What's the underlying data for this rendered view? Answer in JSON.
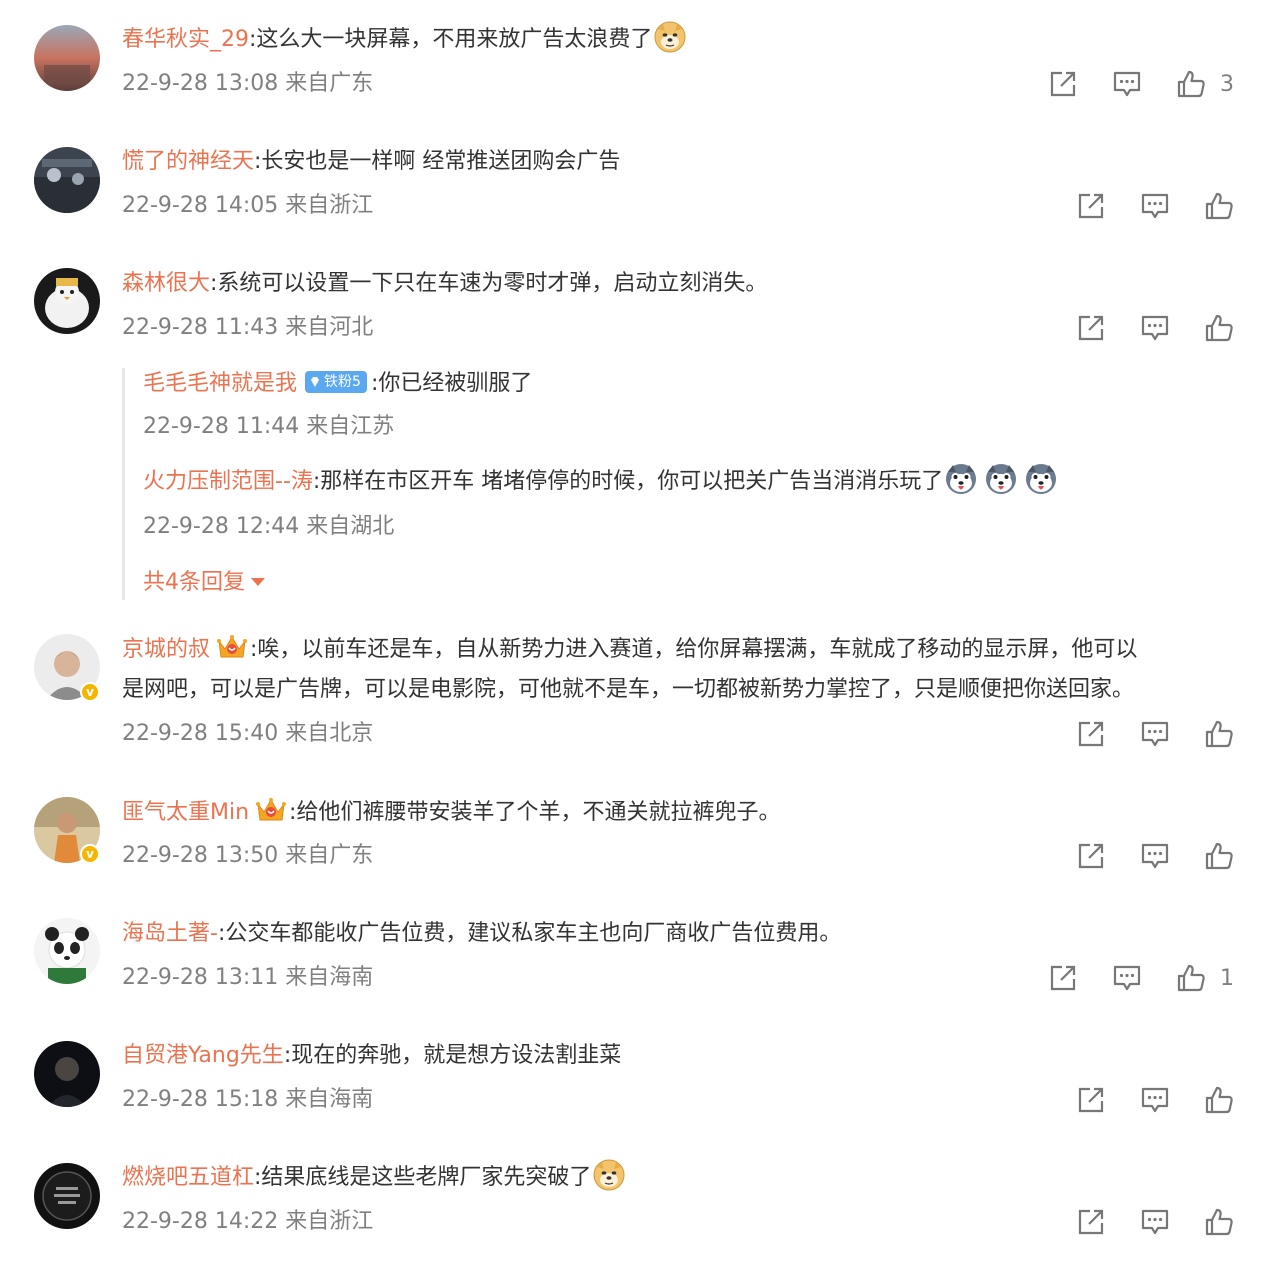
{
  "colors": {
    "username": "#eb7350",
    "meta": "#808080",
    "text": "#333333",
    "fan_badge": "#5aa8f0"
  },
  "comments": [
    {
      "user": "春华秋实_29",
      "text": ":这么大一块屏幕，不用来放广告太浪费了",
      "time": "22-9-28 13:08 来自广东",
      "likes": "3",
      "emoji": "doge"
    },
    {
      "user": "慌了的神经天",
      "text": ":长安也是一样啊  经常推送团购会广告",
      "time": "22-9-28 14:05 来自浙江",
      "likes": ""
    },
    {
      "user": "森林很大",
      "text": ":系统可以设置一下只在车速为零时才弹，启动立刻消失。",
      "time": "22-9-28 11:43 来自河北",
      "likes": "",
      "replies": [
        {
          "user": "毛毛毛神就是我",
          "badge": "铁粉5",
          "text": ":你已经被驯服了",
          "time": "22-9-28 11:44 来自江苏"
        },
        {
          "user": "火力压制范围--涛",
          "text": ":那样在市区开车 堵堵停停的时候，你可以把关广告当消消乐玩了",
          "time": "22-9-28 12:44 来自湖北",
          "emoji": "husky x3"
        }
      ],
      "more_replies": "共4条回复"
    },
    {
      "user": "京城的叔",
      "text_line1": ":唉，以前车还是车，自从新势力进入赛道，给你屏幕摆满，车就成了移动的显示屏，他可以",
      "text_line2": "是网吧，可以是广告牌，可以是电影院，可他就不是车，一切都被新势力掌控了，只是顺便把你送回家。",
      "time": "22-9-28 15:40 来自北京",
      "likes": ""
    },
    {
      "user": "匪气太重Min",
      "text": ":给他们裤腰带安装羊了个羊，不通关就拉裤兜子。",
      "time": "22-9-28 13:50 来自广东",
      "likes": ""
    },
    {
      "user": "海岛土著-",
      "text": ":公交车都能收广告位费，建议私家车主也向厂商收广告位费用。",
      "time": "22-9-28 13:11 来自海南",
      "likes": "1"
    },
    {
      "user": "自贸港Yang先生",
      "text": ":现在的奔驰，就是想方设法割韭菜",
      "time": "22-9-28 15:18 来自海南",
      "likes": ""
    },
    {
      "user": "燃烧吧五道杠",
      "text": ":结果底线是这些老牌厂家先突破了",
      "time": "22-9-28 14:22 来自浙江",
      "likes": "",
      "emoji": "doge"
    }
  ]
}
